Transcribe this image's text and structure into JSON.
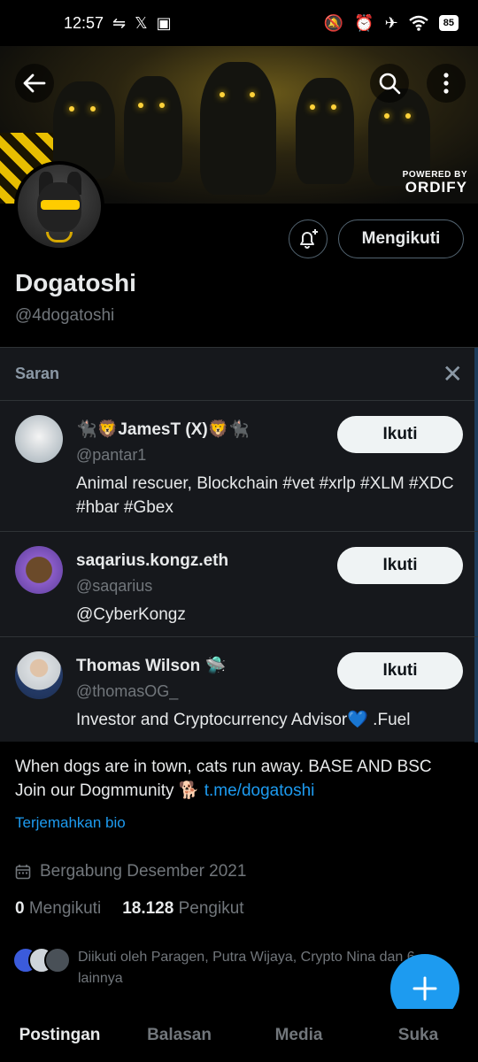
{
  "status_bar": {
    "time": "12:57",
    "left_icons": [
      "sync-icon",
      "x-logo-icon",
      "app-icon"
    ],
    "right_icons": [
      "bell-off-icon",
      "alarm-icon",
      "airplane-icon",
      "wifi-icon"
    ],
    "battery": "85"
  },
  "banner": {
    "powered_by": "POWERED BY",
    "brand": "ORDIFY",
    "accent": "#f3c700"
  },
  "profile": {
    "display_name": "Dogatoshi",
    "handle": "@4dogatoshi",
    "following_button": "Mengikuti"
  },
  "suggestions": {
    "title": "Saran",
    "items": [
      {
        "name": "🐈‍⬛🦁JamesT (X)🦁🐈‍⬛",
        "handle": "@pantar1",
        "bio": "Animal rescuer,  Blockchain #vet #xrlp #XLM #XDC #hbar #Gbex",
        "button": "Ikuti"
      },
      {
        "name": "saqarius.kongz.eth",
        "handle": "@saqarius",
        "bio": "@CyberKongz",
        "button": "Ikuti"
      },
      {
        "name": "Thomas Wilson 🛸",
        "handle": "@thomasOG_",
        "bio": "Investor and Cryptocurrency Advisor💙 .Fuel",
        "button": "Ikuti"
      }
    ]
  },
  "bio": {
    "text": "When dogs are in town, cats run away. BASE AND BSC Join our Dogmmunity 🐕 ",
    "link": "t.me/dogatoshi",
    "translate": "Terjemahkan bio"
  },
  "joined": "Bergabung Desember 2021",
  "stats": {
    "following_count": "0",
    "following_label": "Mengikuti",
    "followers_count": "18.128",
    "followers_label": "Pengikut"
  },
  "followed_by": "Diikuti oleh Paragen, Putra Wijaya, Crypto Nina dan 6 lainnya",
  "tabs": [
    "Postingan",
    "Balasan",
    "Media",
    "Suka"
  ],
  "colors": {
    "link": "#1d9bf0",
    "background": "#000000",
    "panel": "#16181c"
  }
}
